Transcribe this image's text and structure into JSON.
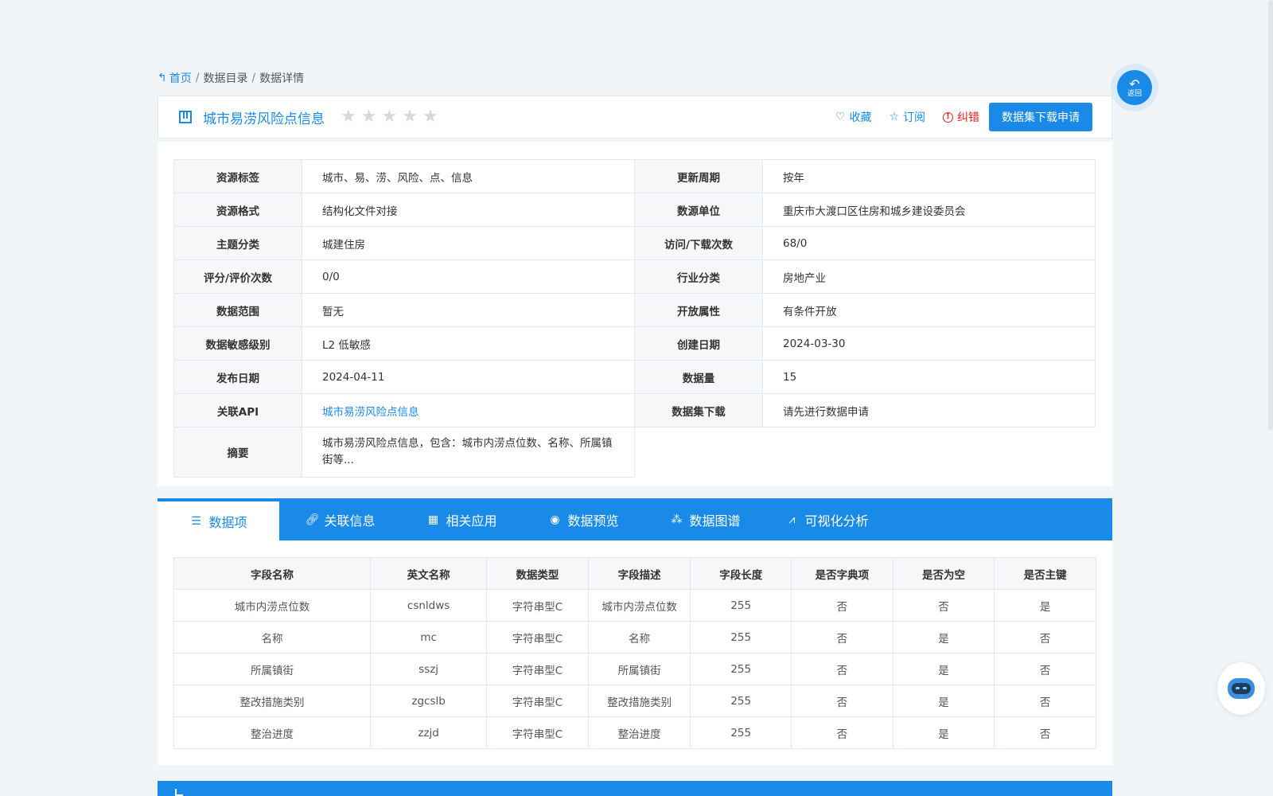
{
  "breadcrumb": {
    "home": "首页",
    "items": [
      "数据目录",
      "数据详情"
    ]
  },
  "header": {
    "title": "城市易涝风险点信息",
    "rating_stars": 0,
    "actions": {
      "favorite": "收藏",
      "subscribe": "订阅",
      "report": "纠错",
      "download": "数据集下载申请"
    }
  },
  "info": {
    "rows": [
      {
        "k1": "资源标签",
        "v1": "城市、易、涝、风险、点、信息",
        "k2": "更新周期",
        "v2": "按年"
      },
      {
        "k1": "资源格式",
        "v1": "结构化文件对接",
        "k2": "数源单位",
        "v2": "重庆市大渡口区住房和城乡建设委员会"
      },
      {
        "k1": "主题分类",
        "v1": "城建住房",
        "k2": "访问/下载次数",
        "v2": "68/0"
      },
      {
        "k1": "评分/评价次数",
        "v1": "0/0",
        "k2": "行业分类",
        "v2": "房地产业"
      },
      {
        "k1": "数据范围",
        "v1": "暂无",
        "k2": "开放属性",
        "v2": "有条件开放"
      },
      {
        "k1": "数据敏感级别",
        "v1": "L2 低敏感",
        "k2": "创建日期",
        "v2": "2024-03-30"
      },
      {
        "k1": "发布日期",
        "v1": "2024-04-11",
        "k2": "数据量",
        "v2": "15"
      },
      {
        "k1": "关联API",
        "v1": "城市易涝风险点信息",
        "k2": "数据集下载",
        "v2": "请先进行数据申请"
      }
    ],
    "summary": {
      "k": "摘要",
      "v": "城市易涝风险点信息，包含：城市内涝点位数、名称、所属镇街等..."
    }
  },
  "tabs": [
    "数据项",
    "关联信息",
    "相关应用",
    "数据预览",
    "数据图谱",
    "可视化分析"
  ],
  "fields": {
    "headers": [
      "字段名称",
      "英文名称",
      "数据类型",
      "字段描述",
      "字段长度",
      "是否字典项",
      "是否为空",
      "是否主键"
    ],
    "rows": [
      [
        "城市内涝点位数",
        "csnldws",
        "字符串型C",
        "城市内涝点位数",
        "255",
        "否",
        "否",
        "是"
      ],
      [
        "名称",
        "mc",
        "字符串型C",
        "名称",
        "255",
        "否",
        "是",
        "否"
      ],
      [
        "所属镇街",
        "sszj",
        "字符串型C",
        "所属镇街",
        "255",
        "否",
        "是",
        "否"
      ],
      [
        "整改措施类别",
        "zgcslb",
        "字符串型C",
        "整改措施类别",
        "255",
        "否",
        "是",
        "否"
      ],
      [
        "整治进度",
        "zzjd",
        "字符串型C",
        "整治进度",
        "255",
        "否",
        "是",
        "否"
      ]
    ]
  },
  "back_button": {
    "label": "返回"
  },
  "colors": {
    "primary": "#1a8ae8",
    "danger": "#e02424",
    "background": "#f2f5f8"
  },
  "icons": {
    "home": "reply-arrow-icon",
    "title": "grid-icon",
    "favorite": "heart-icon",
    "subscribe": "star-icon",
    "report": "alert-circle-icon",
    "assistant": "robot-icon"
  }
}
